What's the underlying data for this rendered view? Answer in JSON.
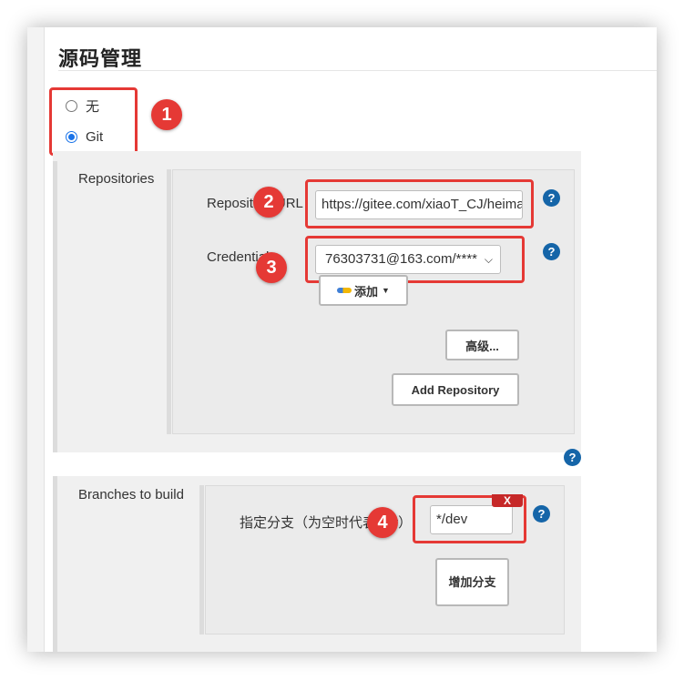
{
  "section": {
    "title": "源码管理"
  },
  "scm_options": [
    {
      "label": "无",
      "selected": false
    },
    {
      "label": "Git",
      "selected": true
    }
  ],
  "repositories": {
    "label": "Repositories",
    "url_label": "Repository URL",
    "url_value": "https://gitee.com/xiaoT_CJ/heima",
    "credentials_label": "Credentials",
    "credentials_value": "76303731@163.com/****",
    "add_label": "添加",
    "advanced_label": "高级...",
    "add_repo_label": "Add Repository"
  },
  "branches": {
    "label": "Branches to build",
    "spec_label": "指定分支（为空时代表any）",
    "spec_value": "*/dev",
    "delete_label": "X",
    "add_branch_label": "增加分支"
  },
  "help_icon_text": "?",
  "annotations": [
    "1",
    "2",
    "3",
    "4"
  ],
  "colors": {
    "highlight": "#e53935",
    "help": "#1565a8",
    "radio": "#1a73e8"
  }
}
